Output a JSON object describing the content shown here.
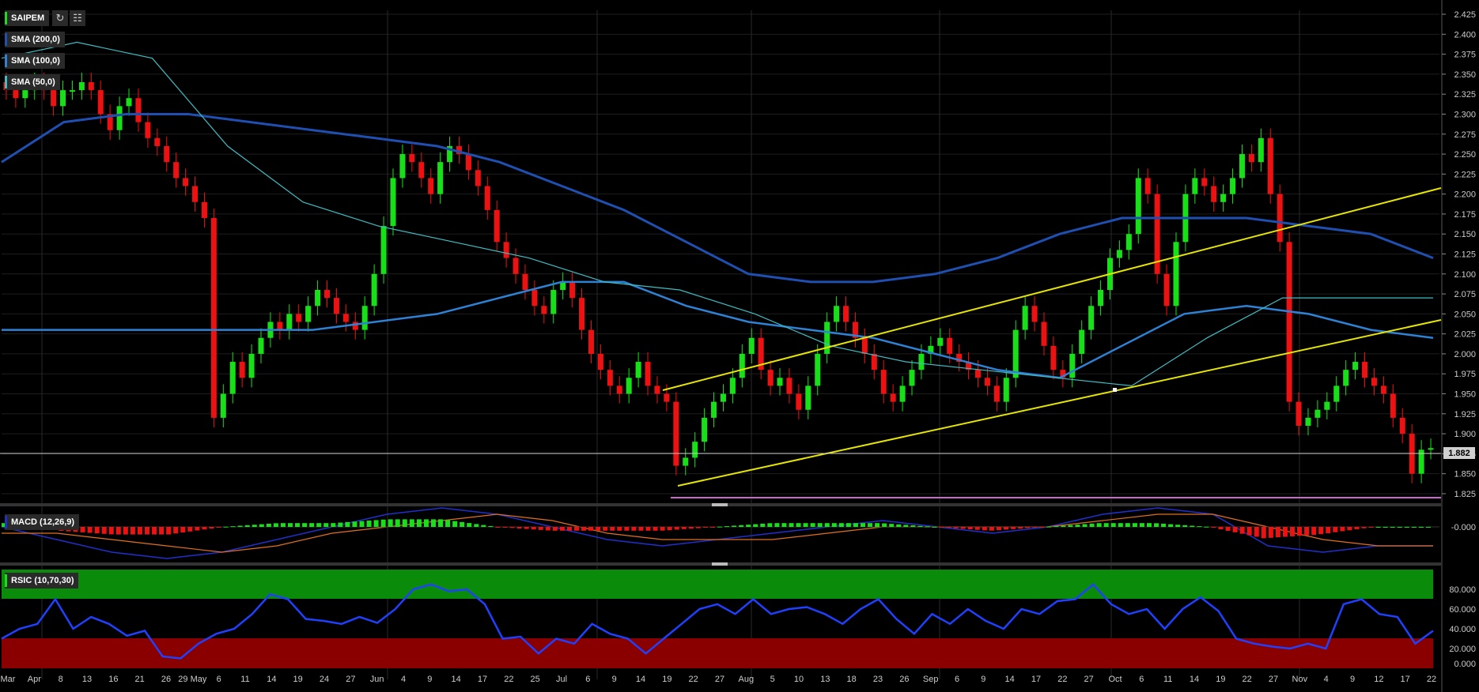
{
  "symbol": "SAIPEM",
  "colors": {
    "up": "#18e018",
    "down": "#ee1111",
    "sma200": "#1f4fb0",
    "sma100": "#2e82d6",
    "sma50": "#40bcc2",
    "trendline": "#e6e600",
    "support": "#cc66cc",
    "macd_line": "#2030cc",
    "signal_line": "#e07020",
    "rsi_line": "#2040ff",
    "rsi_overbought": "#0a8c0a",
    "rsi_oversold": "#8a0000",
    "price_tag": "#d0d0d0"
  },
  "overlays": {
    "sma200_label": "SMA (200,0)",
    "sma100_label": "SMA (100,0)",
    "sma50_label": "SMA (50,0)"
  },
  "indicators": {
    "macd_label": "MACD (12,26,9)",
    "rsi_label": "RSIC (10,70,30)"
  },
  "current_price": "1.882",
  "price_axis": [
    "2.425",
    "2.400",
    "2.375",
    "2.350",
    "2.325",
    "2.300",
    "2.275",
    "2.250",
    "2.225",
    "2.200",
    "2.175",
    "2.150",
    "2.125",
    "2.100",
    "2.075",
    "2.050",
    "2.025",
    "2.000",
    "1.975",
    "1.950",
    "1.925",
    "1.900",
    "1.875",
    "1.850",
    "1.825"
  ],
  "macd_axis": [
    "-0.000"
  ],
  "rsi_axis": [
    "80.000",
    "60.000",
    "40.000",
    "20.000",
    "0.000"
  ],
  "x_labels": [
    "Mar",
    "Apr",
    "8",
    "13",
    "16",
    "21",
    "26",
    "29 May",
    "6",
    "11",
    "14",
    "19",
    "24",
    "27",
    "Jun",
    "4",
    "9",
    "14",
    "17",
    "22",
    "25",
    "Jul",
    "6",
    "9",
    "14",
    "19",
    "22",
    "27",
    "Aug",
    "5",
    "10",
    "13",
    "18",
    "23",
    "26",
    "Sep",
    "6",
    "9",
    "14",
    "17",
    "22",
    "27",
    "Oct",
    "6",
    "11",
    "14",
    "19",
    "22",
    "27",
    "Nov",
    "4",
    "9",
    "12",
    "17",
    "22"
  ],
  "chart_data": {
    "type": "candlestick",
    "ylim": [
      1.82,
      2.43
    ],
    "series_names": [
      "SMA (200,0)",
      "SMA (100,0)",
      "SMA (50,0)"
    ],
    "candles_close": [
      2.33,
      2.32,
      2.33,
      2.34,
      2.33,
      2.31,
      2.33,
      2.33,
      2.34,
      2.33,
      2.3,
      2.28,
      2.31,
      2.32,
      2.29,
      2.27,
      2.26,
      2.24,
      2.22,
      2.21,
      2.19,
      2.17,
      1.92,
      1.95,
      1.99,
      1.97,
      2.0,
      2.02,
      2.04,
      2.03,
      2.05,
      2.04,
      2.06,
      2.08,
      2.07,
      2.05,
      2.04,
      2.03,
      2.06,
      2.1,
      2.16,
      2.22,
      2.25,
      2.24,
      2.22,
      2.2,
      2.24,
      2.26,
      2.25,
      2.23,
      2.21,
      2.18,
      2.14,
      2.12,
      2.1,
      2.08,
      2.06,
      2.05,
      2.08,
      2.09,
      2.07,
      2.03,
      2.0,
      1.98,
      1.96,
      1.95,
      1.97,
      1.99,
      1.96,
      1.95,
      1.94,
      1.86,
      1.87,
      1.89,
      1.92,
      1.94,
      1.95,
      1.97,
      2.0,
      2.02,
      1.98,
      1.96,
      1.97,
      1.95,
      1.93,
      1.96,
      2.0,
      2.04,
      2.06,
      2.04,
      2.02,
      2.0,
      1.98,
      1.95,
      1.94,
      1.96,
      1.98,
      2.0,
      2.01,
      2.02,
      2.0,
      1.99,
      1.98,
      1.97,
      1.96,
      1.94,
      1.97,
      2.03,
      2.06,
      2.04,
      2.01,
      1.98,
      1.97,
      2.0,
      2.03,
      2.06,
      2.08,
      2.12,
      2.13,
      2.15,
      2.22,
      2.2,
      2.1,
      2.06,
      2.14,
      2.2,
      2.22,
      2.21,
      2.19,
      2.2,
      2.22,
      2.25,
      2.24,
      2.27,
      2.2,
      2.14,
      1.94,
      1.91,
      1.92,
      1.93,
      1.94,
      1.96,
      1.98,
      1.99,
      1.97,
      1.96,
      1.95,
      1.92,
      1.9,
      1.85,
      1.88,
      1.882
    ],
    "sma200": [
      2.24,
      2.29,
      2.3,
      2.3,
      2.29,
      2.28,
      2.27,
      2.26,
      2.24,
      2.21,
      2.18,
      2.14,
      2.1,
      2.09,
      2.09,
      2.1,
      2.12,
      2.15,
      2.17,
      2.17,
      2.17,
      2.16,
      2.15,
      2.12
    ],
    "sma100": [
      2.03,
      2.03,
      2.03,
      2.03,
      2.03,
      2.03,
      2.04,
      2.05,
      2.07,
      2.09,
      2.09,
      2.06,
      2.04,
      2.03,
      2.02,
      2.0,
      1.98,
      1.97,
      2.01,
      2.05,
      2.06,
      2.05,
      2.03,
      2.02
    ],
    "sma50": [
      2.37,
      2.39,
      2.37,
      2.26,
      2.19,
      2.16,
      2.14,
      2.12,
      2.09,
      2.08,
      2.05,
      2.01,
      1.99,
      1.98,
      1.97,
      1.96,
      2.02,
      2.07,
      2.07,
      2.07
    ],
    "macd": [
      0.0,
      -0.02,
      -0.04,
      -0.05,
      -0.04,
      -0.02,
      0.0,
      0.02,
      0.03,
      0.02,
      0.0,
      -0.02,
      -0.03,
      -0.02,
      -0.01,
      0.0,
      0.01,
      0.0,
      -0.01,
      0.0,
      0.02,
      0.03,
      0.02,
      -0.03,
      -0.04,
      -0.03,
      -0.03
    ],
    "macd_signal": [
      -0.01,
      -0.01,
      -0.02,
      -0.03,
      -0.04,
      -0.03,
      -0.01,
      0.0,
      0.01,
      0.02,
      0.01,
      -0.01,
      -0.02,
      -0.02,
      -0.02,
      -0.01,
      0.0,
      0.0,
      0.0,
      0.0,
      0.01,
      0.02,
      0.02,
      0.0,
      -0.02,
      -0.03,
      -0.03
    ],
    "rsi": [
      30,
      40,
      45,
      70,
      40,
      52,
      45,
      33,
      38,
      12,
      10,
      25,
      35,
      40,
      55,
      75,
      70,
      50,
      48,
      45,
      52,
      46,
      60,
      80,
      85,
      78,
      80,
      65,
      30,
      32,
      15,
      30,
      25,
      45,
      35,
      30,
      15,
      30,
      45,
      60,
      65,
      55,
      70,
      55,
      60,
      62,
      55,
      45,
      60,
      70,
      50,
      35,
      55,
      45,
      60,
      48,
      40,
      60,
      55,
      68,
      70,
      85,
      65,
      55,
      60,
      40,
      60,
      72,
      58,
      30,
      25,
      22,
      20,
      25,
      20,
      65,
      70,
      55,
      52,
      25,
      38
    ]
  }
}
